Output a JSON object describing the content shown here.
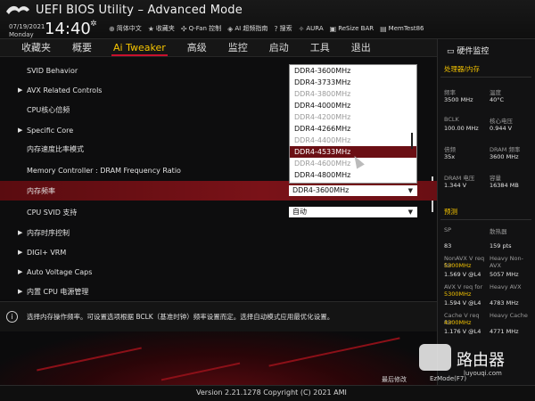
{
  "header": {
    "title": "UEFI BIOS Utility – Advanced Mode",
    "date": "07/19/2021",
    "day": "Monday",
    "time": "14:40",
    "tools": [
      {
        "icon": "globe-icon",
        "label": "简体中文"
      },
      {
        "icon": "star-icon",
        "label": "收藏夹"
      },
      {
        "icon": "fan-icon",
        "label": "Q-Fan 控制"
      },
      {
        "icon": "ai-icon",
        "label": "AI 超频指南"
      },
      {
        "icon": "help-icon",
        "label": "搜索"
      },
      {
        "icon": "aura-icon",
        "label": "AURA"
      },
      {
        "icon": "resize-bar-icon",
        "label": "ReSize BAR"
      },
      {
        "icon": "memtest-icon",
        "label": "MemTest86"
      }
    ]
  },
  "menu": [
    "收藏夹",
    "概要",
    "Ai Tweaker",
    "高级",
    "监控",
    "启动",
    "工具",
    "退出"
  ],
  "menu_active_index": 2,
  "settings": [
    {
      "label": "SVID Behavior",
      "arrow": false
    },
    {
      "label": "AVX Related Controls",
      "arrow": true
    },
    {
      "label": "CPU核心倍频",
      "arrow": false
    },
    {
      "label": "Specific Core",
      "arrow": true
    },
    {
      "label": "内存速度比率模式",
      "arrow": false
    },
    {
      "label": "Memory Controller : DRAM Frequency Ratio",
      "arrow": false
    },
    {
      "label": "内存频率",
      "arrow": false,
      "value": "DDR4-3600MHz"
    },
    {
      "label": "CPU SVID 支持",
      "arrow": false,
      "value": "自动"
    },
    {
      "label": "内存时序控制",
      "arrow": true
    },
    {
      "label": "DIGI+ VRM",
      "arrow": true
    },
    {
      "label": "Auto Voltage Caps",
      "arrow": true
    },
    {
      "label": "内置 CPU 电源管理",
      "arrow": true
    }
  ],
  "dropdown": {
    "options": [
      {
        "text": "DDR4-3600MHz",
        "state": "normal"
      },
      {
        "text": "DDR4-3733MHz",
        "state": "normal"
      },
      {
        "text": "DDR4-3800MHz",
        "state": "dim"
      },
      {
        "text": "DDR4-4000MHz",
        "state": "normal"
      },
      {
        "text": "DDR4-4200MHz",
        "state": "dim"
      },
      {
        "text": "DDR4-4266MHz",
        "state": "normal"
      },
      {
        "text": "DDR4-4400MHz",
        "state": "dim"
      },
      {
        "text": "DDR4-4533MHz",
        "state": "selected"
      },
      {
        "text": "DDR4-4600MHz",
        "state": "dim"
      },
      {
        "text": "DDR4-4800MHz",
        "state": "normal"
      }
    ]
  },
  "help_text": "选择内存操作频率。可设置选项根据 BCLK（基准时钟）频率设置而定。选择自动模式应用最优化设置。",
  "panel": {
    "title": "硬件监控",
    "cpu_mem": {
      "heading": "处理器/内存",
      "items": [
        {
          "k": "频率",
          "v": "3500 MHz"
        },
        {
          "k": "温度",
          "v": "40°C"
        },
        {
          "k": "BCLK",
          "v": "100.00 MHz"
        },
        {
          "k": "核心电压",
          "v": "0.944 V"
        },
        {
          "k": "倍频",
          "v": "35x"
        },
        {
          "k": "DRAM 频率",
          "v": "3600 MHz"
        },
        {
          "k": "DRAM 电压",
          "v": "1.344 V"
        },
        {
          "k": "容量",
          "v": "16384 MB"
        }
      ]
    },
    "prediction": {
      "heading": "预测",
      "items": [
        {
          "k": "SP",
          "v": "83"
        },
        {
          "k": "散热器",
          "v": "159 pts"
        },
        {
          "k": "NonAVX V req for",
          "k2": "5300MHz",
          "v": "1.569 V @L4"
        },
        {
          "k": "Heavy Non-AVX",
          "v": "5057 MHz"
        },
        {
          "k": "AVX V req for",
          "k2": "5300MHz",
          "v": "1.594 V @L4"
        },
        {
          "k": "Heavy AVX",
          "v": "4783 MHz"
        },
        {
          "k": "Cache V req for",
          "k2": "4300MHz",
          "v": "1.176 V @L4"
        },
        {
          "k": "Heavy Cache",
          "v": "4771 MHz"
        }
      ]
    }
  },
  "footer": {
    "version": "Version 2.21.1278 Copyright (C) 2021 AMI",
    "last_modified": "最后修改",
    "ezmode": "EzMode(F7)"
  },
  "watermark": {
    "text": "路由器",
    "url": "luyouqi.com"
  },
  "colors": {
    "accent": "#f5c400",
    "highlight": "#7a1218",
    "selected": "#6b0f14"
  }
}
